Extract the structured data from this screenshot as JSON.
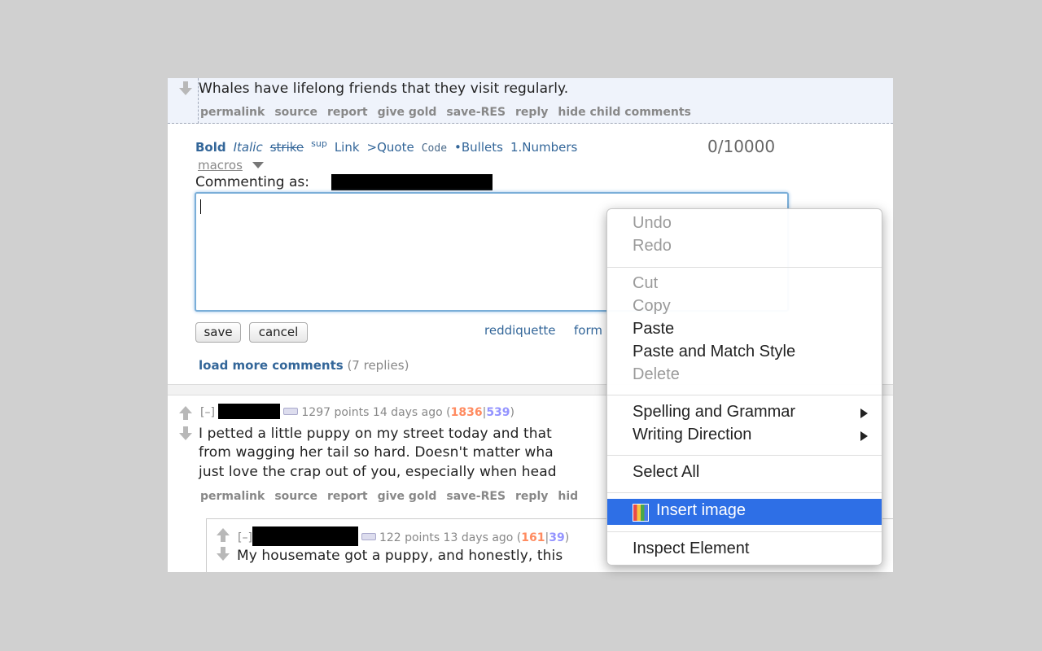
{
  "comment1": {
    "body": "Whales have lifelong friends that they visit regularly.",
    "links": [
      "permalink",
      "source",
      "report",
      "give gold",
      "save-RES",
      "reply",
      "hide child comments"
    ]
  },
  "editor": {
    "toolbar": [
      "Bold",
      "Italic",
      "strike",
      "sup",
      "Link",
      ">Quote",
      "Code",
      "•Bullets",
      "1.Numbers"
    ],
    "counter": "0/10000",
    "macros": "macros",
    "commenting_as": "Commenting as:",
    "textarea_value": "",
    "save": "save",
    "cancel": "cancel",
    "reddiquette": "reddiquette",
    "formatting": "form"
  },
  "load_more": {
    "link": "load more comments",
    "count": "(7 replies)"
  },
  "comment2": {
    "toggle": "[–]",
    "points": "1297 points 14 days ago (",
    "ups": "1836",
    "pipe": "|",
    "downs": "539",
    "close": ")",
    "line1": "I petted a little puppy on my street today and that",
    "line2": "from wagging her tail so hard. Doesn't matter wha",
    "line3": "just love the crap out of you, especially when head",
    "links": [
      "permalink",
      "source",
      "report",
      "give gold",
      "save-RES",
      "reply",
      "hid"
    ]
  },
  "comment3": {
    "toggle": "[–]",
    "points": "122 points 13 days ago (",
    "ups": "161",
    "pipe": "|",
    "downs": "39",
    "close": ")",
    "line1": "My housemate got a puppy, and honestly, this"
  },
  "context_menu": {
    "undo": "Undo",
    "redo": "Redo",
    "cut": "Cut",
    "copy": "Copy",
    "paste": "Paste",
    "paste_match": "Paste and Match Style",
    "delete": "Delete",
    "spelling": "Spelling and Grammar",
    "writing": "Writing Direction",
    "select_all": "Select All",
    "insert_image": "Insert image",
    "inspect": "Inspect Element"
  },
  "colors": {
    "link": "#336699",
    "upvotes": "#ff8b60",
    "downvotes": "#9494ff",
    "menu_highlight": "#2e6fe6"
  }
}
